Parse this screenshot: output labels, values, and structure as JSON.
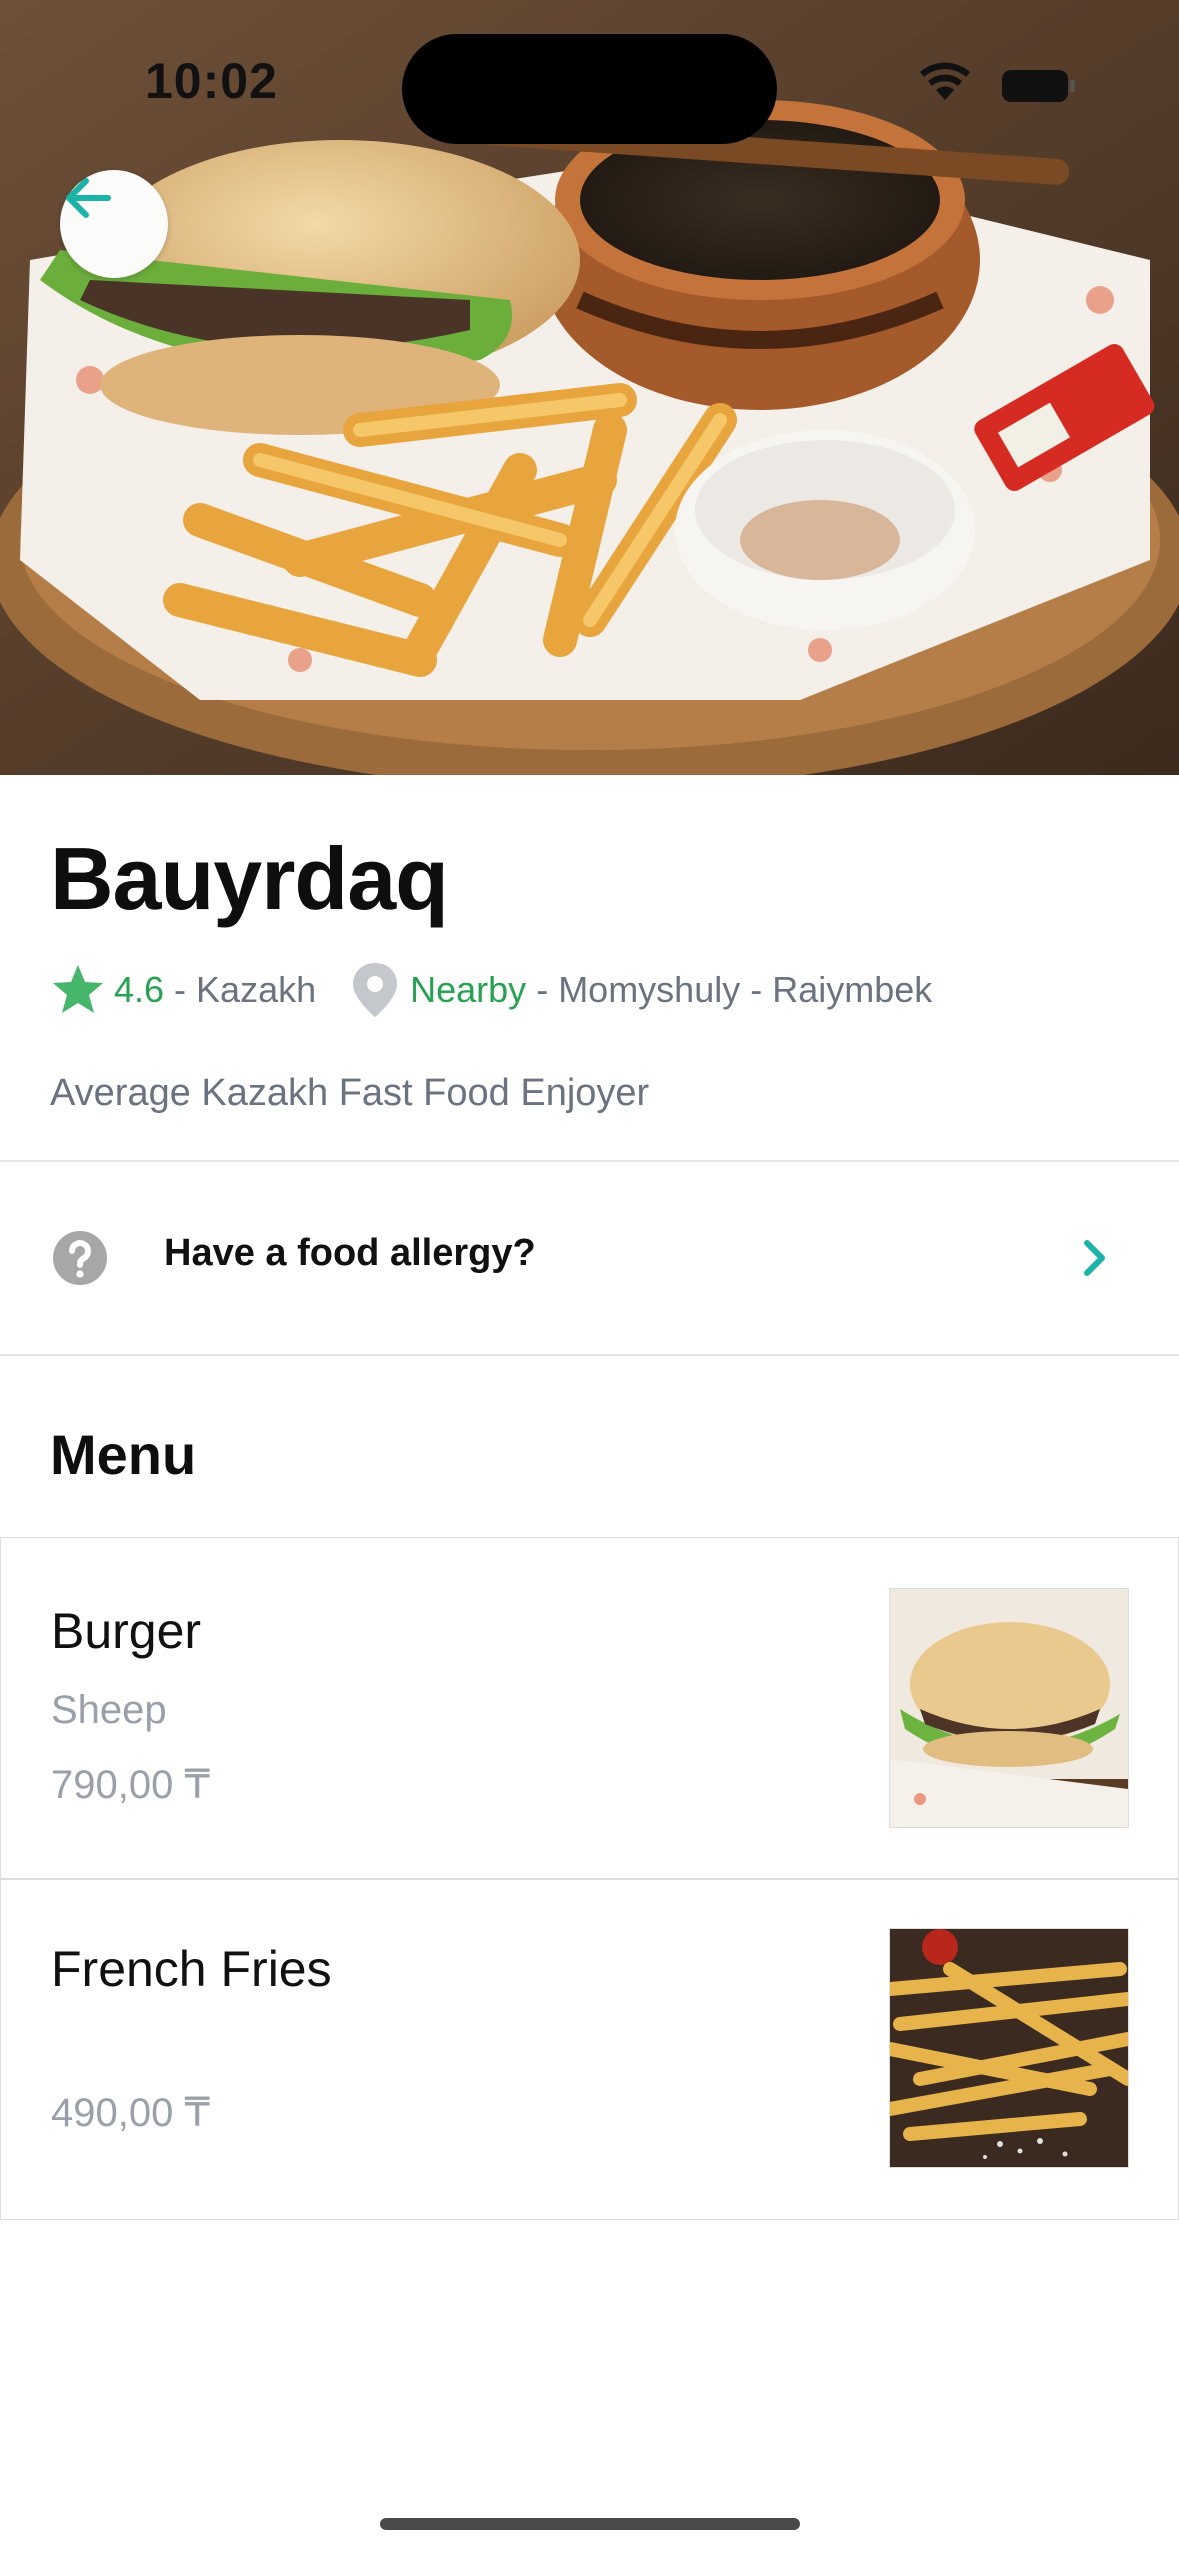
{
  "status_bar": {
    "time": "10:02"
  },
  "hero": {
    "back_icon": "arrow-left-icon"
  },
  "restaurant": {
    "name": "Bauyrdaq",
    "rating": "4.6",
    "cuisine": "Kazakh",
    "distance": "Nearby",
    "location": "Momyshuly - Raiymbek",
    "description": "Average Kazakh Fast Food Enjoyer",
    "separator": "-"
  },
  "allergy": {
    "label": "Have a food allergy?"
  },
  "menu": {
    "title": "Menu",
    "items": [
      {
        "name": "Burger",
        "description": "Sheep",
        "price": "790,00 ₸"
      },
      {
        "name": "French Fries",
        "description": "",
        "price": "490,00 ₸"
      }
    ]
  },
  "colors": {
    "accent_teal": "#1bb3a7",
    "green": "#27a152",
    "muted_text": "#6b7380"
  }
}
